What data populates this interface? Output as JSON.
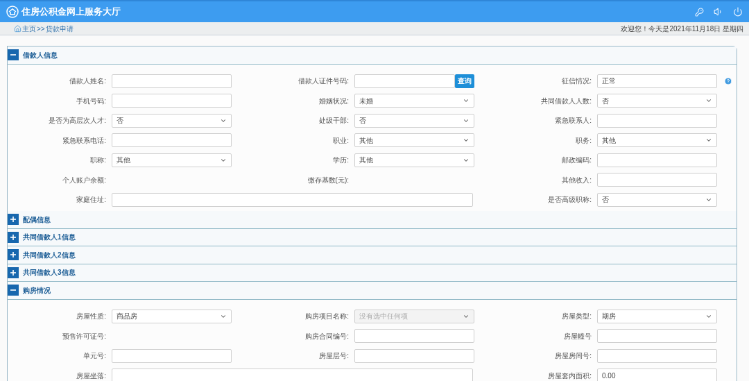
{
  "header": {
    "title": "住房公积金网上服务大厅"
  },
  "breadcrumb": {
    "home": "主页",
    "separator": ">>",
    "current": "贷款申请",
    "greeting": "欢迎您！今天是2021年11月18日 星期四"
  },
  "sections": [
    {
      "title": "借款人信息",
      "expanded": true,
      "fields": [
        {
          "label": "借款人姓名:",
          "kind": "input"
        },
        {
          "label": "借款人证件号码:",
          "kind": "input",
          "button": "查询"
        },
        {
          "label": "征信情况:",
          "kind": "input",
          "value": "正常",
          "help": true
        },
        {
          "label": "手机号码:",
          "kind": "input"
        },
        {
          "label": "婚姻状况:",
          "kind": "select",
          "value": "未婚"
        },
        {
          "label": "共同借款人人数:",
          "kind": "select",
          "value": "否"
        },
        {
          "label": "是否为高层次人才:",
          "kind": "select",
          "value": "否"
        },
        {
          "label": "处级干部:",
          "kind": "select",
          "value": "否"
        },
        {
          "label": "紧急联系人:",
          "kind": "input"
        },
        {
          "label": "紧急联系电话:",
          "kind": "input"
        },
        {
          "label": "职业:",
          "kind": "select",
          "value": "其他"
        },
        {
          "label": "职务:",
          "kind": "select",
          "value": "其他"
        },
        {
          "label": "职称:",
          "kind": "select",
          "value": "其他"
        },
        {
          "label": "学历:",
          "kind": "select",
          "value": "其他"
        },
        {
          "label": "邮政编码:",
          "kind": "input"
        },
        {
          "label": "个人账户余额:",
          "kind": "text"
        },
        {
          "label": "缴存基数(元):",
          "kind": "text"
        },
        {
          "label": "其他收入:",
          "kind": "input"
        },
        {
          "label": "家庭住址:",
          "kind": "input",
          "wide": true
        },
        {
          "label": "是否高级职称:",
          "kind": "select",
          "value": "否"
        }
      ]
    },
    {
      "title": "配偶信息",
      "expanded": false
    },
    {
      "title": "共同借款人1信息",
      "expanded": false
    },
    {
      "title": "共同借款人2信息",
      "expanded": false
    },
    {
      "title": "共同借款人3信息",
      "expanded": false
    },
    {
      "title": "购房情况",
      "expanded": true,
      "fields": [
        {
          "label": "房屋性质:",
          "kind": "select",
          "value": "商品房"
        },
        {
          "label": "购房项目名称:",
          "kind": "select",
          "placeholder": "没有选中任何项",
          "disabled": true
        },
        {
          "label": "房屋类型:",
          "kind": "select",
          "value": "期房"
        },
        {
          "label": "预售许可证号:",
          "kind": "text"
        },
        {
          "label": "购房合同编号:",
          "kind": "input"
        },
        {
          "label": "房屋幢号",
          "kind": "input"
        },
        {
          "label": "单元号:",
          "kind": "input"
        },
        {
          "label": "房屋层号:",
          "kind": "input"
        },
        {
          "label": "房屋房间号:",
          "kind": "input"
        },
        {
          "label": "房屋坐落:",
          "kind": "input",
          "wide": true
        },
        {
          "label": "房屋套内面积:",
          "kind": "input",
          "value": "0.00"
        }
      ]
    }
  ]
}
